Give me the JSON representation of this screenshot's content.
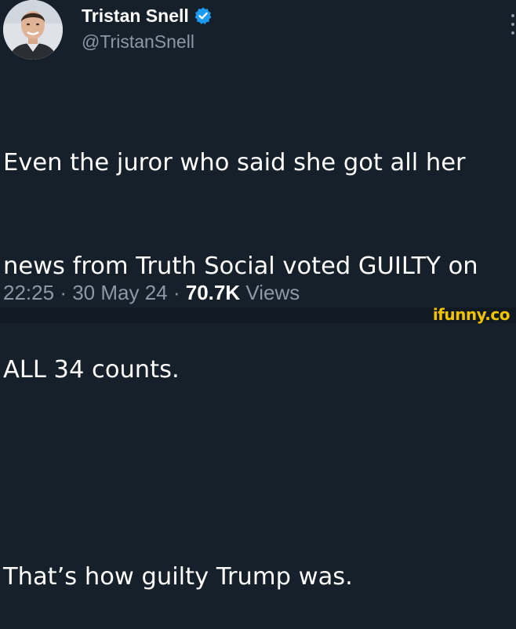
{
  "author": {
    "display_name": "Tristan Snell",
    "handle": "@TristanSnell",
    "verified": true,
    "avatar": "avatar-photo"
  },
  "icons": {
    "verified": "verified-badge-icon",
    "more": "more-options-icon"
  },
  "tweet": {
    "lines": [
      "Even the juror who said she got all her",
      "news from Truth Social voted GUILTY on",
      "ALL 34 counts.",
      "",
      "That’s how guilty Trump was."
    ]
  },
  "meta": {
    "time": "22:25",
    "separator": "·",
    "date": "30 May 24",
    "views_count": "70.7K",
    "views_label": "Views"
  },
  "watermark": "ifunny.co",
  "colors": {
    "background": "#15202b",
    "text": "#ffffff",
    "secondary": "#8b98a5",
    "verified": "#1d9bf0",
    "watermark": "#f2c400"
  }
}
